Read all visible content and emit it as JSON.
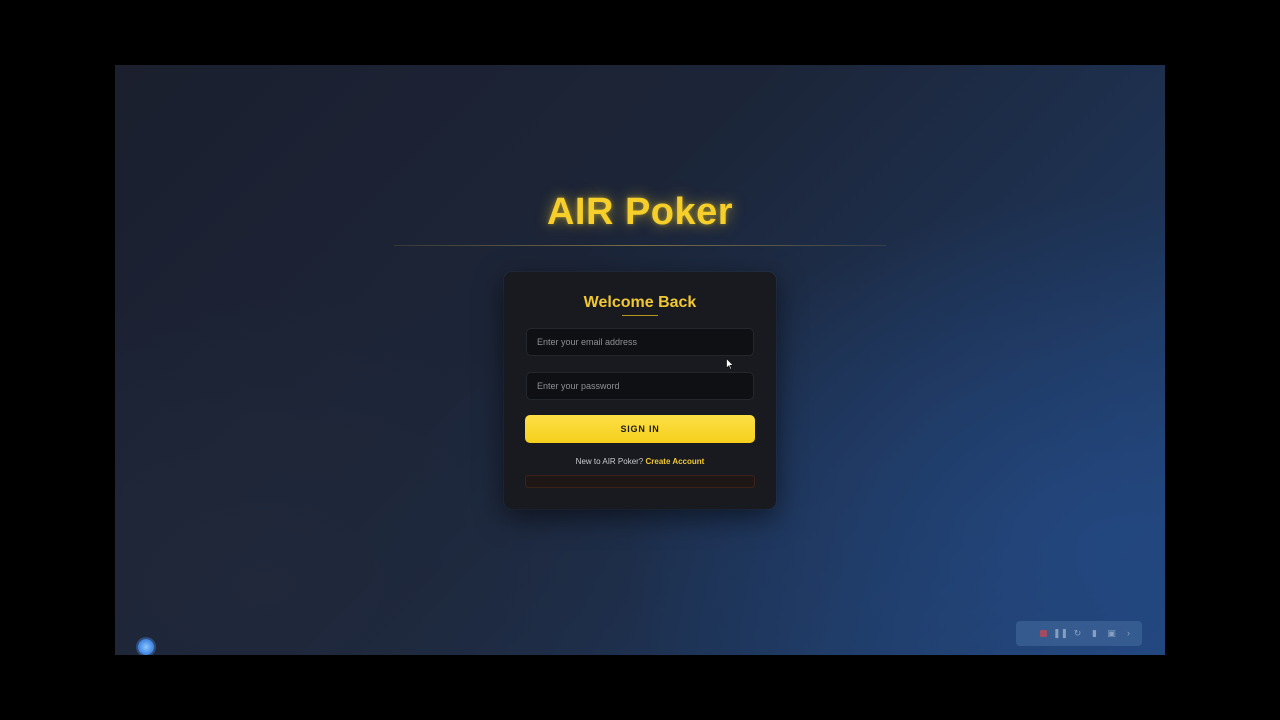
{
  "app": {
    "title": "AIR Poker"
  },
  "login": {
    "heading": "Welcome Back",
    "email_placeholder": "Enter your email address",
    "password_placeholder": "Enter your password",
    "signin_label": "SIGN IN",
    "signup_prompt": "New to AIR Poker?",
    "signup_link": "Create Account"
  },
  "toolbar": {
    "icons": [
      "stop-icon",
      "pause-icon",
      "restart-icon",
      "trash-icon",
      "screen-icon",
      "chevron-right-icon"
    ]
  },
  "colors": {
    "accent": "#f6cf2a",
    "button": "#fde047",
    "card": "#181a1f"
  }
}
